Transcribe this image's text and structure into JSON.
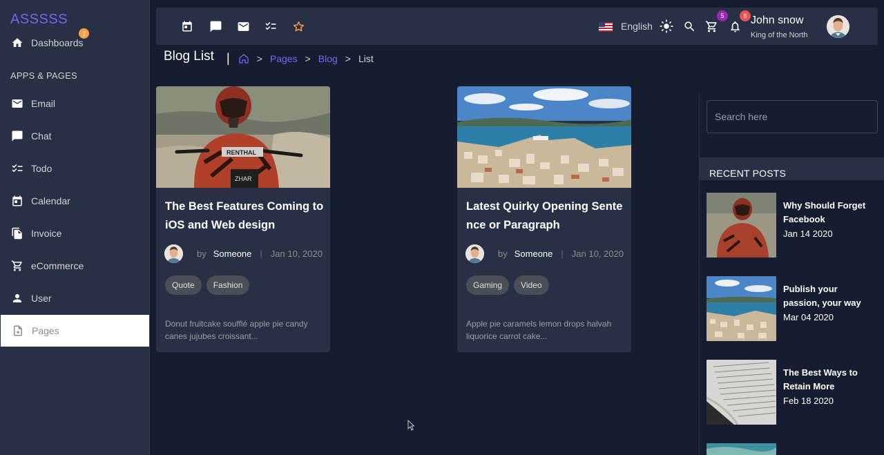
{
  "brand": "ASSSSS",
  "sidebar": {
    "dashboards": {
      "label": "Dashboards",
      "badge": "2",
      "icon": "home-icon"
    },
    "section_title": "APPS & PAGES",
    "items": [
      {
        "label": "Email",
        "icon": "mail-icon"
      },
      {
        "label": "Chat",
        "icon": "chat-icon"
      },
      {
        "label": "Todo",
        "icon": "checklist-icon"
      },
      {
        "label": "Calendar",
        "icon": "calendar-icon"
      },
      {
        "label": "Invoice",
        "icon": "document-icon"
      },
      {
        "label": "eCommerce",
        "icon": "cart-icon"
      },
      {
        "label": "User",
        "icon": "user-icon"
      },
      {
        "label": "Pages",
        "icon": "page-star-icon",
        "active": true
      }
    ]
  },
  "navbar": {
    "language": "English",
    "cart_badge": "5",
    "notif_badge": "6",
    "user_name": "John snow",
    "user_role": "King of the North"
  },
  "breadcrumb": {
    "title": "Blog List",
    "items": [
      "Pages",
      "Blog",
      "List"
    ]
  },
  "posts": [
    {
      "title": "The Best Features Coming to iOS and Web design",
      "by": "by",
      "author": "Someone",
      "date": "Jan 10, 2020",
      "tags": [
        "Quote",
        "Fashion"
      ],
      "excerpt": "Donut fruitcake soufflé apple pie candy canes jujubes croissant..."
    },
    {
      "title": "Latest Quirky Opening Sente nce or Paragraph",
      "by": "by",
      "author": "Someone",
      "date": "Jan 10, 2020",
      "tags": [
        "Gaming",
        "Video"
      ],
      "excerpt": "Apple pie caramels lemon drops halvah liquorice carrot cake..."
    }
  ],
  "right": {
    "search_placeholder": "Search here",
    "recent_title": "RECENT POSTS",
    "recent": [
      {
        "title": "Why Should Forget Facebook",
        "date": "Jan 14 2020"
      },
      {
        "title": "Publish your passion, your way",
        "date": "Mar 04 2020"
      },
      {
        "title": "The Best Ways to Retain More",
        "date": "Feb 18 2020"
      }
    ]
  },
  "colors": {
    "primary": "#7367f0",
    "background": "#161d31",
    "card": "#283046",
    "badge_orange": "#ff9f43",
    "badge_purple": "#9c27b0",
    "badge_red": "#ea5455"
  }
}
